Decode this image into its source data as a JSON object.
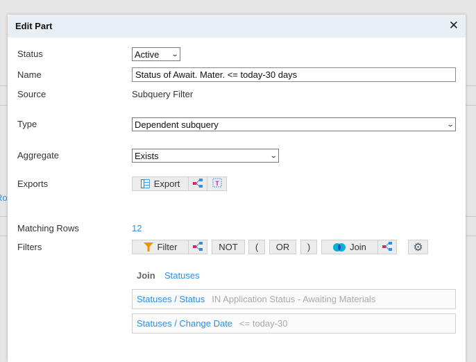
{
  "background": {
    "partial_text": "Ro"
  },
  "dialog": {
    "title": "Edit Part",
    "close_icon": "close-icon"
  },
  "form": {
    "status": {
      "label": "Status",
      "value": "Active"
    },
    "name": {
      "label": "Name",
      "value": "Status of Await. Mater.  <= today-30 days"
    },
    "source": {
      "label": "Source",
      "value": "Subquery Filter"
    },
    "type": {
      "label": "Type",
      "value": "Dependent subquery"
    },
    "aggregate": {
      "label": "Aggregate",
      "value": "Exists"
    },
    "exports": {
      "label": "Exports",
      "export_button": "Export"
    },
    "matching_rows": {
      "label": "Matching Rows",
      "value": "12"
    },
    "filters": {
      "label": "Filters",
      "filter_button": "Filter",
      "not_button": "NOT",
      "open_paren_button": "(",
      "or_button": "OR",
      "close_paren_button": ")",
      "join_button": "Join"
    }
  },
  "join": {
    "label": "Join",
    "table": "Statuses",
    "conditions": [
      {
        "field": "Statuses / Status",
        "condition": "IN Application Status - Awaiting Materials"
      },
      {
        "field": "Statuses / Change Date",
        "condition": "<= today-30"
      }
    ]
  },
  "colors": {
    "accent": "#2a8fe6",
    "header_bg": "#e8f0f6",
    "button_bg": "#ececec"
  }
}
